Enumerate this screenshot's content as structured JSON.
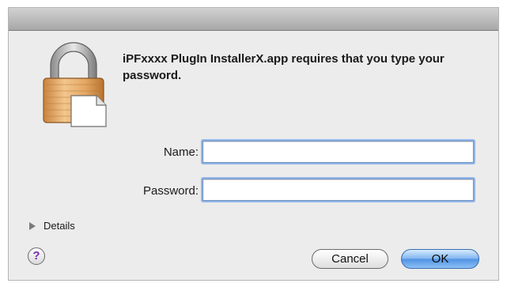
{
  "dialog": {
    "message": "iPFxxxx  PlugIn InstallerX.app requires that you type your password.",
    "name_label": "Name:",
    "name_value": "",
    "password_label": "Password:",
    "password_value": "",
    "details_label": "Details",
    "help_label": "?",
    "cancel_label": "Cancel",
    "ok_label": "OK"
  },
  "colors": {
    "window_bg": "#ececec",
    "focus_ring": "#93b7e8",
    "default_button": "#4f92e3",
    "help_glyph": "#7a2bb0"
  },
  "icons": {
    "auth": "lock-icon",
    "disclosure": "disclosure-triangle-icon"
  }
}
